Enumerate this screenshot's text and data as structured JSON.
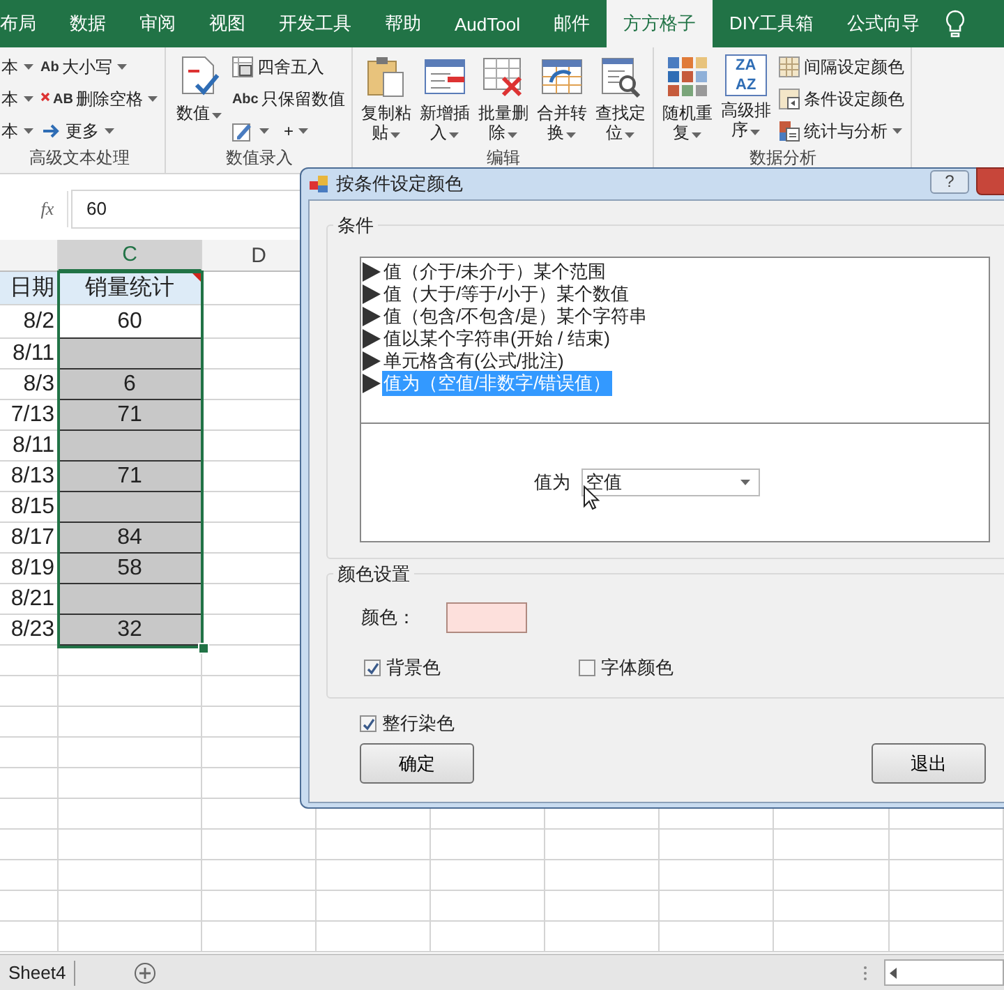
{
  "ribbon_tabs": [
    {
      "label": "布局",
      "selected": false
    },
    {
      "label": "数据",
      "selected": false
    },
    {
      "label": "审阅",
      "selected": false
    },
    {
      "label": "视图",
      "selected": false
    },
    {
      "label": "开发工具",
      "selected": false
    },
    {
      "label": "帮助",
      "selected": false
    },
    {
      "label": "AudTool",
      "selected": false
    },
    {
      "label": "邮件",
      "selected": false
    },
    {
      "label": "方方格子",
      "selected": true
    },
    {
      "label": "DIY工具箱",
      "selected": false
    },
    {
      "label": "公式向导",
      "selected": false
    }
  ],
  "ribbon_groups": [
    {
      "label": "高级文本处理",
      "columns": [
        {
          "kind": "stack",
          "rows": [
            [
              {
                "label": "本",
                "dropdown": true
              }
            ],
            [
              {
                "label": "本",
                "dropdown": true
              }
            ],
            [
              {
                "label": "本",
                "dropdown": true
              }
            ]
          ]
        },
        {
          "kind": "stack",
          "rows": [
            [
              {
                "icon_text": "Ab",
                "label": "大小写",
                "dropdown": true
              }
            ],
            [
              {
                "icon_text": "AB",
                "label": "删除空格",
                "dropdown": true
              }
            ],
            [
              {
                "label": "更多",
                "dropdown": true
              }
            ]
          ]
        }
      ]
    },
    {
      "label": "数值录入",
      "columns": [
        {
          "kind": "large",
          "label": "数值",
          "dropdown": true
        },
        {
          "kind": "stack",
          "rows": [
            [
              {
                "label": "四舍五入",
                "dropdown": false
              }
            ],
            [
              {
                "icon_text": "Abc",
                "label": "只保留数值",
                "dropdown": false
              }
            ],
            [
              {
                "dropdown": true
              },
              {
                "label": "+",
                "dropdown": true
              }
            ]
          ]
        }
      ]
    },
    {
      "label": "编辑",
      "columns": [
        {
          "kind": "large",
          "label": "复制粘贴",
          "dropdown": true
        },
        {
          "kind": "large",
          "label": "新增插入",
          "dropdown": true
        },
        {
          "kind": "large",
          "label": "批量删除",
          "dropdown": true
        },
        {
          "kind": "large",
          "label": "合并转换",
          "dropdown": true
        },
        {
          "kind": "large",
          "label": "查找定位",
          "dropdown": true
        }
      ]
    },
    {
      "label": "数据分析",
      "columns": [
        {
          "kind": "large",
          "label": "随机重复",
          "dropdown": true
        },
        {
          "kind": "large",
          "icon_text": "ZAAZ",
          "label": "高级排序",
          "dropdown": true
        },
        {
          "kind": "stack",
          "rows": [
            [
              {
                "label": "间隔设定颜色",
                "dropdown": false
              }
            ],
            [
              {
                "label": "条件设定颜色",
                "dropdown": false
              }
            ],
            [
              {
                "label": "统计与分析",
                "dropdown": true
              }
            ]
          ]
        }
      ]
    }
  ],
  "formula_bar": {
    "fx": "fx",
    "value": "60"
  },
  "column_headers": [
    {
      "label": "C",
      "selected": true
    },
    {
      "label": "D",
      "selected": false
    }
  ],
  "rows": [
    {
      "kind": "header",
      "date": "日期",
      "value": "销量统计",
      "has_comment": true,
      "highlighted": false
    },
    {
      "kind": "data",
      "date": "8/2",
      "value": "60",
      "has_comment": false,
      "highlighted": false
    },
    {
      "kind": "data",
      "date": "8/11",
      "has_comment": false,
      "highlighted": true
    },
    {
      "kind": "data",
      "date": "8/3",
      "value": "6",
      "has_comment": false,
      "highlighted": true
    },
    {
      "kind": "data",
      "date": "7/13",
      "value": "71",
      "has_comment": false,
      "highlighted": true
    },
    {
      "kind": "data",
      "date": "8/11",
      "has_comment": false,
      "highlighted": true
    },
    {
      "kind": "data",
      "date": "8/13",
      "value": "71",
      "has_comment": false,
      "highlighted": true
    },
    {
      "kind": "data",
      "date": "8/15",
      "has_comment": false,
      "highlighted": true
    },
    {
      "kind": "data",
      "date": "8/17",
      "value": "84",
      "has_comment": false,
      "highlighted": true
    },
    {
      "kind": "data",
      "date": "8/19",
      "value": "58",
      "has_comment": false,
      "highlighted": true
    },
    {
      "kind": "data",
      "date": "8/21",
      "has_comment": false,
      "highlighted": true
    },
    {
      "kind": "data",
      "date": "8/23",
      "value": "32",
      "has_comment": false,
      "highlighted": true
    }
  ],
  "sheet_tabs": [
    {
      "label": "Sheet4"
    }
  ],
  "dialog": {
    "title": "按条件设定颜色",
    "help": "?",
    "condition_group": {
      "label": "条件",
      "items": [
        {
          "label": "值（介于/未介于）某个范围",
          "selected": false
        },
        {
          "label": "值（大于/等于/小于）某个数值",
          "selected": false
        },
        {
          "label": "值（包含/不包含/是）某个字符串",
          "selected": false
        },
        {
          "label": "值以某个字符串(开始 / 结束)",
          "selected": false
        },
        {
          "label": "单元格含有(公式/批注)",
          "selected": false
        },
        {
          "label": "值为（空值/非数字/错误值）",
          "selected": true
        }
      ],
      "value_label": "值为",
      "value": "空值"
    },
    "color_group": {
      "label": "颜色设置",
      "color_label": "颜色：",
      "color": "#fde0dc",
      "checkboxes": [
        {
          "label": "背景色",
          "checked": true
        },
        {
          "label": "字体颜色",
          "checked": false
        }
      ]
    },
    "options": [
      {
        "label": "整行染色",
        "checked": true
      }
    ],
    "buttons": [
      {
        "label": "确定"
      },
      {
        "label": "退出"
      }
    ]
  }
}
